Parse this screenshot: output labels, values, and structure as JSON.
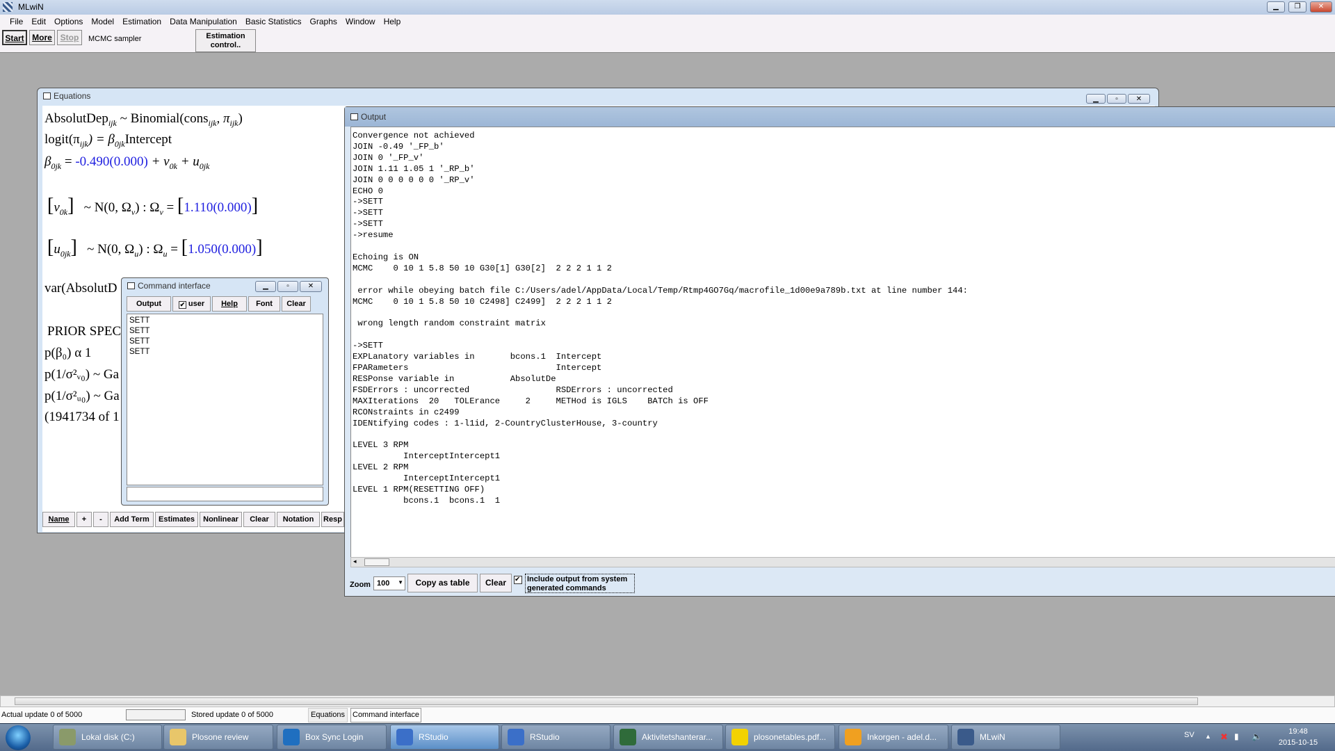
{
  "app": {
    "title": "MLwiN"
  },
  "menu": [
    "File",
    "Edit",
    "Options",
    "Model",
    "Estimation",
    "Data Manipulation",
    "Basic Statistics",
    "Graphs",
    "Window",
    "Help"
  ],
  "toolbar": {
    "start": "Start",
    "more": "More",
    "stop": "Stop",
    "sampler": "MCMC sampler",
    "estimation_control_1": "Estimation",
    "estimation_control_2": "control.."
  },
  "equations": {
    "title": "Equations",
    "line1": {
      "a": "AbsolutDep",
      "s1": "ijk",
      "b": " ~ Binomial(cons",
      "s2": "ijk",
      "c": ", π",
      "s3": "ijk",
      "d": ")"
    },
    "line2": {
      "a": "logit(π",
      "s1": "ijk",
      "b": ") = β",
      "s2": "0jk",
      "c": "Intercept"
    },
    "line3": {
      "a": "β",
      "s1": "0jk",
      "b": " = ",
      "coef": "-0.490(0.000)",
      "c": " + v",
      "s2": "0k",
      "d": " + u",
      "s3": "0jk"
    },
    "line4": {
      "v": "v",
      "s1": "0k",
      "b": "~ N(0,  Ω",
      "s2": "v",
      "c": ")  :  Ω",
      "s3": "v",
      "d": " = ",
      "val": "1.110(0.000)"
    },
    "line5": {
      "u": "u",
      "s1": "0jk",
      "b": "~ N(0,  Ω",
      "s2": "u",
      "c": ")  :  Ω",
      "s3": "u",
      "d": " = ",
      "val": "1.050(0.000)"
    },
    "line6": "var(AbsolutD",
    "prior": "PRIOR SPEC",
    "p1": "p(β₀) α  1",
    "p2": "p(1/σ²ᵥ₀) ~ Ga",
    "p3": "p(1/σ²ᵤ₀) ~ Ga",
    "p4": "(1941734 of 1",
    "buttons": [
      "Name",
      "+",
      "-",
      "Add Term",
      "Estimates",
      "Nonlinear",
      "Clear",
      "Notation",
      "Resp"
    ]
  },
  "command_interface": {
    "title": "Command interface",
    "output": "Output",
    "user": "user",
    "user_checked": true,
    "help": "Help",
    "font": "Font",
    "clear": "Clear",
    "lines": [
      "SETT",
      "SETT",
      "SETT",
      "SETT"
    ],
    "input": ""
  },
  "output": {
    "title": "Output",
    "text": "Convergence not achieved\nJOIN -0.49 '_FP_b'\nJOIN 0 '_FP_v'\nJOIN 1.11 1.05 1 '_RP_b'\nJOIN 0 0 0 0 0 0 '_RP_v'\nECHO 0\n->SETT\n->SETT\n->SETT\n->resume\n\nEchoing is ON\nMCMC    0 10 1 5.8 50 10 G30[1] G30[2]  2 2 2 1 1 2\n\n error while obeying batch file C:/Users/adel/AppData/Local/Temp/Rtmp4GO7Gq/macrofile_1d00e9a789b.txt at line number 144:\nMCMC    0 10 1 5.8 50 10 C2498] C2499]  2 2 2 1 1 2\n\n wrong length random constraint matrix\n\n->SETT\nEXPLanatory variables in       bcons.1  Intercept\nFPARameters                             Intercept\nRESPonse variable in           AbsolutDe\nFSDErrors : uncorrected                 RSDErrors : uncorrected\nMAXIterations  20   TOLErance     2     METHod is IGLS    BATCh is OFF\nRCONstraints in c2499\nIDENtifying codes : 1-l1id, 2-CountryClusterHouse, 3-country\n\nLEVEL 3 RPM\n          InterceptIntercept1\nLEVEL 2 RPM\n          InterceptIntercept1\nLEVEL 1 RPM(RESETTING OFF)\n          bcons.1  bcons.1  1",
    "zoom_label": "Zoom",
    "zoom_value": "100",
    "copy_as_table": "Copy as table",
    "clear": "Clear",
    "include_label_1": "Include output from system",
    "include_label_2": "generated commands",
    "include_checked": true
  },
  "status": {
    "actual": "Actual update 0 of 5000",
    "stored": "Stored update 0 of 5000",
    "tab_equations": "Equations",
    "tab_command": "Command interface"
  },
  "taskbar": {
    "items": [
      {
        "label": "Lokal disk (C:)",
        "icon": "drive-icon",
        "color": "#8a9a6a"
      },
      {
        "label": "Plosone review",
        "icon": "folder-icon",
        "color": "#e8c66a"
      },
      {
        "label": "Box Sync Login",
        "icon": "box-icon",
        "color": "#1f6fc0"
      },
      {
        "label": "RStudio",
        "icon": "rstudio-icon",
        "color": "#3b6fc8",
        "active": true
      },
      {
        "label": "RStudio",
        "icon": "rstudio-icon",
        "color": "#3b6fc8"
      },
      {
        "label": "Aktivitetshanterar...",
        "icon": "task-manager-icon",
        "color": "#2f6b3a"
      },
      {
        "label": "plosonetables.pdf...",
        "icon": "pdf-icon",
        "color": "#f2d200"
      },
      {
        "label": "Inkorgen - adel.d...",
        "icon": "outlook-icon",
        "color": "#f0a020"
      },
      {
        "label": "MLwiN",
        "icon": "mlwin-icon",
        "color": "#3a5a8a"
      }
    ],
    "lang": "SV",
    "time": "19:48",
    "date": "2015-10-15"
  }
}
